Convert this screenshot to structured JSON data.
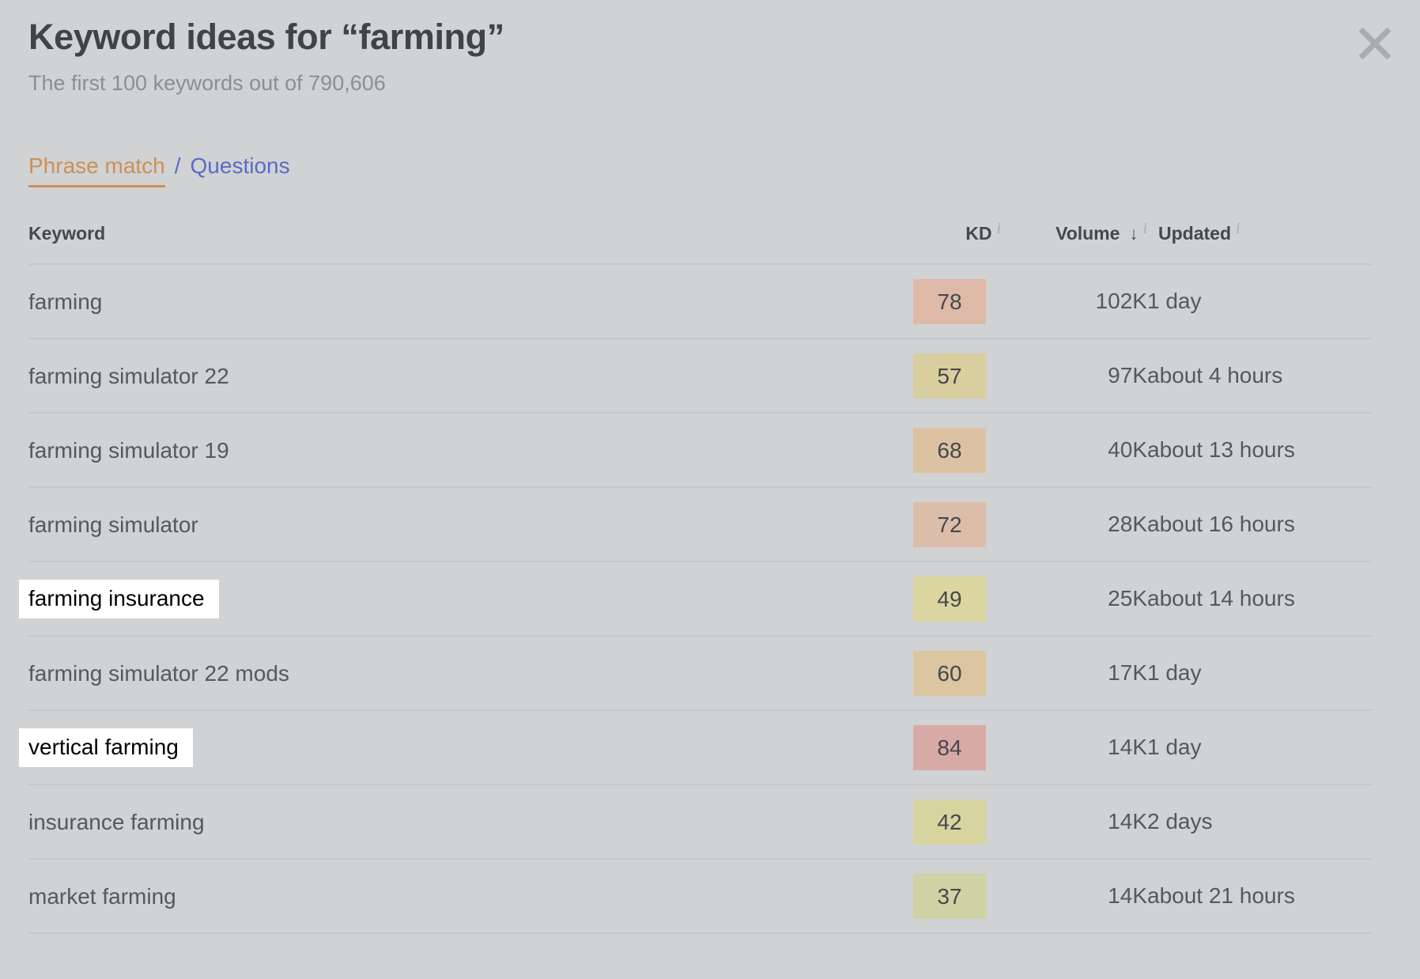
{
  "modal": {
    "title": "Keyword ideas for “farming”",
    "subtitle": "The first 100 keywords out of 790,606",
    "close_icon": "close-icon"
  },
  "tabs": {
    "separator": "/",
    "items": [
      {
        "label": "Phrase match",
        "active": true,
        "color": "#cf8f55"
      },
      {
        "label": "Questions",
        "active": false,
        "color": "#5a6cc4"
      }
    ]
  },
  "table": {
    "columns": [
      {
        "key": "keyword",
        "label": "Keyword",
        "info": false,
        "sorted": false
      },
      {
        "key": "kd",
        "label": "KD",
        "info": true,
        "sorted": false
      },
      {
        "key": "volume",
        "label": "Volume",
        "info": true,
        "sorted": true,
        "sort_icon": "↓"
      },
      {
        "key": "updated",
        "label": "Updated",
        "info": true,
        "sorted": false
      }
    ],
    "info_icon_glyph": "i",
    "rows": [
      {
        "keyword": "farming",
        "kd": "78",
        "kd_color": "#deb9a8",
        "volume": "102K",
        "updated": "1 day",
        "highlighted": false
      },
      {
        "keyword": "farming simulator 22",
        "kd": "57",
        "kd_color": "#d9ce9d",
        "volume": "97K",
        "updated": "about 4 hours",
        "highlighted": false
      },
      {
        "keyword": "farming simulator 19",
        "kd": "68",
        "kd_color": "#dcc1a3",
        "volume": "40K",
        "updated": "about 13 hours",
        "highlighted": false
      },
      {
        "keyword": "farming simulator",
        "kd": "72",
        "kd_color": "#dcbdaa",
        "volume": "28K",
        "updated": "about 16 hours",
        "highlighted": false
      },
      {
        "keyword": "farming insurance",
        "kd": "49",
        "kd_color": "#dbd69f",
        "volume": "25K",
        "updated": "about 14 hours",
        "highlighted": true
      },
      {
        "keyword": "farming simulator 22 mods",
        "kd": "60",
        "kd_color": "#dcc6a1",
        "volume": "17K",
        "updated": "1 day",
        "highlighted": false
      },
      {
        "keyword": "vertical farming",
        "kd": "84",
        "kd_color": "#d8aaa6",
        "volume": "14K",
        "updated": "1 day",
        "highlighted": true
      },
      {
        "keyword": "insurance farming",
        "kd": "42",
        "kd_color": "#d8d4a0",
        "volume": "14K",
        "updated": "2 days",
        "highlighted": false
      },
      {
        "keyword": "market farming",
        "kd": "37",
        "kd_color": "#cfd2a4",
        "volume": "14K",
        "updated": "about 21 hours",
        "highlighted": false
      }
    ]
  },
  "colors": {
    "background": "#d0d2d4",
    "title_text": "#404347",
    "subtitle_text": "#8b8f93",
    "body_text": "#55585c",
    "row_divider": "#c6c8ca",
    "accent_active_tab": "#cf8f55",
    "accent_link": "#5a6cc4",
    "highlight_background": "#ffffff"
  }
}
